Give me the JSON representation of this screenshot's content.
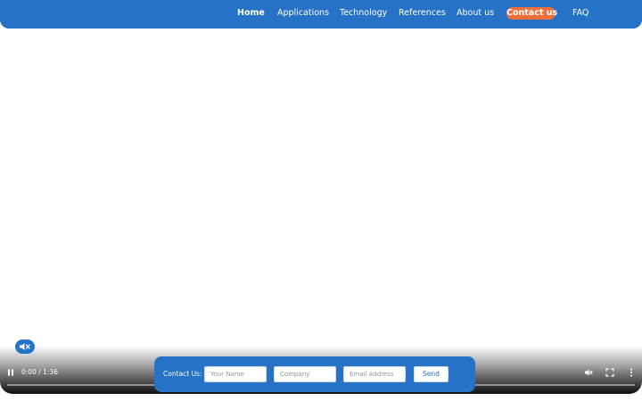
{
  "nav": {
    "items": [
      {
        "label": "Home",
        "active": true
      },
      {
        "label": "Applications",
        "active": false
      },
      {
        "label": "Technology",
        "active": false
      },
      {
        "label": "References",
        "active": false
      },
      {
        "label": "About us",
        "active": false
      }
    ],
    "contact_label": "Contact us",
    "faq_label": "FAQ"
  },
  "video": {
    "time_display": "0:00 / 1:36",
    "progress": 0,
    "controls": {
      "pause_icon": "pause-icon",
      "mute_icon": "volume-muted-icon",
      "fullscreen_icon": "fullscreen-icon",
      "more_icon": "more-vertical-icon",
      "mute_badge_icon": "speaker-muted-icon"
    }
  },
  "contact_form": {
    "label": "Contact Us:",
    "name_placeholder": "Your Name",
    "company_placeholder": "Company",
    "email_placeholder": "Email Address",
    "send_label": "Send"
  },
  "colors": {
    "brand_blue": "#2672c6",
    "accent_orange": "#ef6f3a"
  }
}
